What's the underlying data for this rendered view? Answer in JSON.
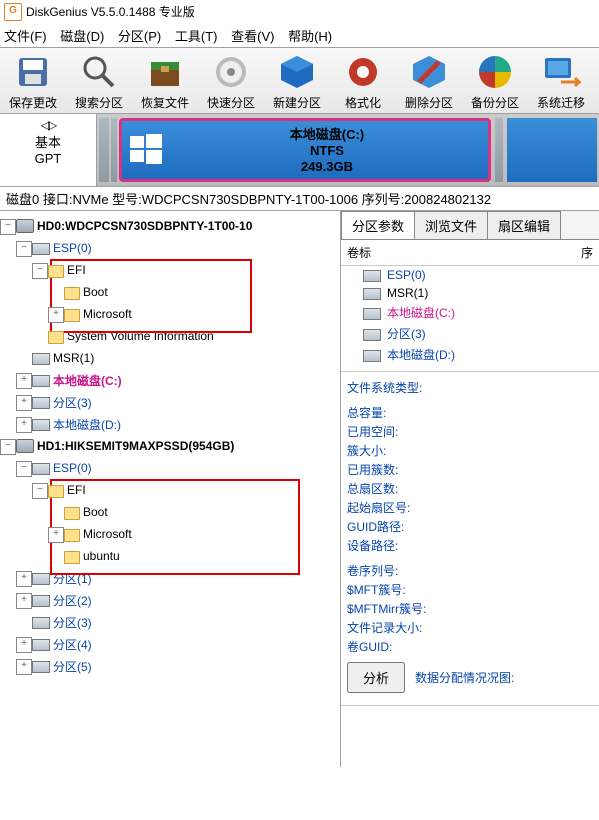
{
  "title": "DiskGenius V5.5.0.1488 专业版",
  "menu": [
    "文件(F)",
    "磁盘(D)",
    "分区(P)",
    "工具(T)",
    "查看(V)",
    "帮助(H)"
  ],
  "toolbar": [
    {
      "name": "save-changes-button",
      "label": "保存更改",
      "icon": "floppy"
    },
    {
      "name": "search-partition-button",
      "label": "搜索分区",
      "icon": "magnifier"
    },
    {
      "name": "recover-files-button",
      "label": "恢复文件",
      "icon": "chest"
    },
    {
      "name": "quick-partition-button",
      "label": "快速分区",
      "icon": "cd"
    },
    {
      "name": "new-partition-button",
      "label": "新建分区",
      "icon": "cube"
    },
    {
      "name": "format-button",
      "label": "格式化",
      "icon": "gear"
    },
    {
      "name": "delete-partition-button",
      "label": "删除分区",
      "icon": "slash"
    },
    {
      "name": "backup-partition-button",
      "label": "备份分区",
      "icon": "pie"
    },
    {
      "name": "system-migrate-button",
      "label": "系统迁移",
      "icon": "screen"
    }
  ],
  "disklayout": {
    "left1": "基本",
    "left2": "GPT",
    "main_part": {
      "name": "本地磁盘(C:)",
      "fs": "NTFS",
      "size": "249.3GB"
    }
  },
  "infoline": "磁盘0  接口:NVMe   型号:WDCPCSN730SDBPNTY-1T00-1006   序列号:200824802132",
  "tree": {
    "hd0": "HD0:WDCPCSN730SDBPNTY-1T00-10",
    "h0_esp": "ESP(0)",
    "h0_efi": "EFI",
    "h0_boot": "Boot",
    "h0_ms": "Microsoft",
    "h0_svi": "System Volume Information",
    "h0_msr": "MSR(1)",
    "h0_c": "本地磁盘(C:)",
    "h0_p3": "分区(3)",
    "h0_d": "本地磁盘(D:)",
    "hd1": "HD1:HIKSEMIT9MAXPSSD(954GB)",
    "h1_esp": "ESP(0)",
    "h1_efi": "EFI",
    "h1_boot": "Boot",
    "h1_ms": "Microsoft",
    "h1_ubu": "ubuntu",
    "h1_p1": "分区(1)",
    "h1_p2": "分区(2)",
    "h1_p3": "分区(3)",
    "h1_p4": "分区(4)",
    "h1_p5": "分区(5)"
  },
  "righttabs": [
    "分区参数",
    "浏览文件",
    "扇区编辑"
  ],
  "right_header_left": "卷标",
  "right_header_right": "序",
  "partlist": [
    {
      "label": "ESP(0)",
      "cls": "blue"
    },
    {
      "label": "MSR(1)",
      "cls": ""
    },
    {
      "label": "本地磁盘(C:)",
      "cls": "magenta"
    },
    {
      "label": "分区(3)",
      "cls": "blue"
    },
    {
      "label": "本地磁盘(D:)",
      "cls": "blue"
    }
  ],
  "props": [
    "文件系统类型:",
    "总容量:",
    "已用空间:",
    "簇大小:",
    "已用簇数:",
    "总扇区数:",
    "起始扇区号:",
    "GUID路径:",
    "设备路径:",
    "卷序列号:",
    "$MFT簇号:",
    "$MFTMirr簇号:",
    "文件记录大小:",
    "卷GUID:"
  ],
  "btn_analyze": "分析",
  "link_allocation": "数据分配情况况图:"
}
